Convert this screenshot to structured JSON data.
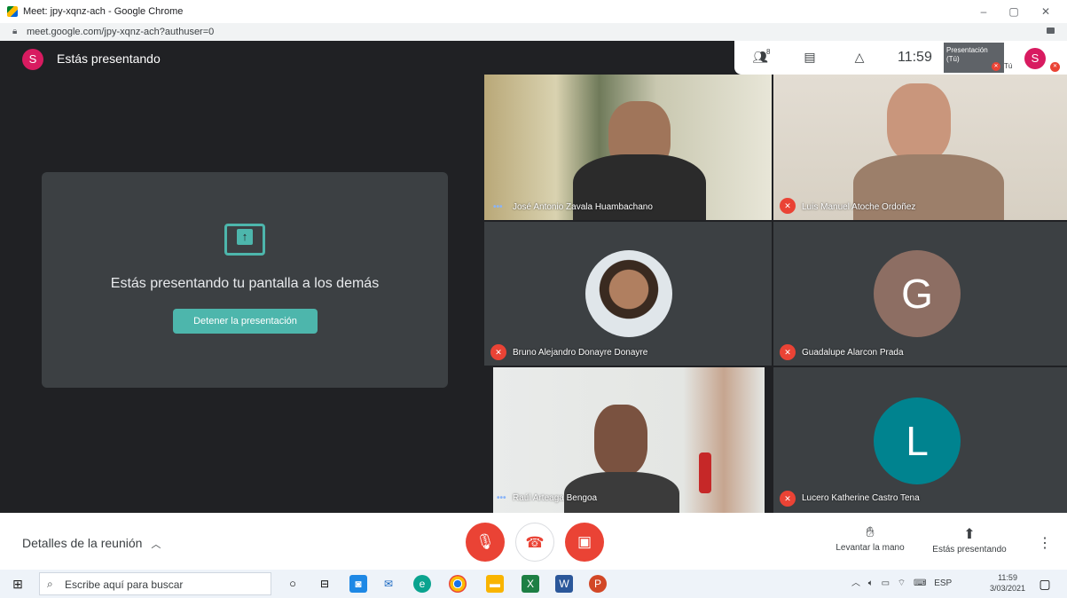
{
  "window": {
    "title": "Meet: jpy-xqnz-ach - Google Chrome",
    "minimize": "–",
    "maximize": "▢",
    "close": "✕"
  },
  "address": {
    "url": "meet.google.com/jpy-xqnz-ach?authuser=0"
  },
  "meet": {
    "self_initial": "S",
    "presenting_title": "Estás presentando",
    "top_right": {
      "people_count": "8",
      "clock": "11:59",
      "mini_tile_label": "Presentación (Tú)",
      "you_label": "Tú"
    },
    "present_card": {
      "message": "Estás presentando tu pantalla a los demás",
      "stop_button": "Detener la presentación"
    },
    "participants": [
      {
        "name": "José Antonio Zavala Huambachano",
        "muted": false
      },
      {
        "name": "Luis Manuel Atoche Ordoñez",
        "muted": true
      },
      {
        "name": "Bruno Alejandro Donayre Donayre",
        "muted": true
      },
      {
        "name": "Guadalupe Alarcon Prada",
        "muted": true,
        "initial": "G",
        "color": "#8d6e63"
      },
      {
        "name": "Raúl Arteaga Bengoa",
        "muted": false
      },
      {
        "name": "Lucero Katherine Castro Tena",
        "muted": true,
        "initial": "L",
        "color": "#00838f"
      }
    ]
  },
  "bottom_bar": {
    "details": "Detalles de la reunión",
    "raise_hand": "Levantar la mano",
    "presenting": "Estás presentando",
    "more": "⋮"
  },
  "taskbar": {
    "search_placeholder": "Escribe aquí para buscar",
    "lang": "ESP",
    "time": "11:59",
    "date": "3/03/2021"
  },
  "colors": {
    "accent": "#4db6ac",
    "danger": "#ea4335",
    "bg": "#202124"
  }
}
